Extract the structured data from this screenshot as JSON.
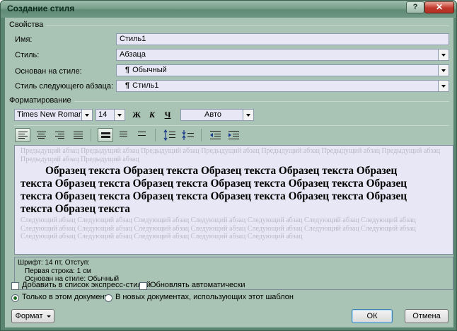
{
  "window": {
    "title": "Создание стиля",
    "help_label": "?",
    "close_label": "✕"
  },
  "properties": {
    "section_title": "Свойства",
    "name_label": "Имя:",
    "name_value": "Стиль1",
    "style_type_label": "Стиль:",
    "style_type_value": "Абзаца",
    "based_on_label": "Основан на стиле:",
    "based_on_value": "Обычный",
    "next_style_label": "Стиль следующего абзаца:",
    "next_style_value": "Стиль1",
    "pilcrow": "¶"
  },
  "formatting": {
    "section_title": "Форматирование",
    "font_name": "Times New Roman (Ос",
    "font_size": "14",
    "bold_label": "Ж",
    "italic_label": "К",
    "underline_label": "Ч",
    "color_value": "Авто"
  },
  "preview": {
    "previous_paragraph": "Предыдущий абзац Предыдущий абзац Предыдущий абзац Предыдущий абзац Предыдущий абзац Предыдущий абзац Предыдущий абзац Предыдущий абзац Предыдущий абзац",
    "sample_line1": "Образец текста Образец текста Образец текста Образец текста Образец",
    "sample_line2": "текста Образец текста Образец текста Образец текста Образец текста Образец",
    "sample_line3": "текста Образец текста Образец текста Образец текста Образец текста Образец",
    "sample_line4": "текста Образец текста",
    "next_paragraph": "Следующий абзац Следующий абзац Следующий абзац Следующий абзац Следующий абзац Следующий абзац Следующий абзац Следующий абзац Следующий абзац Следующий абзац Следующий абзац Следующий абзац Следующий абзац Следующий абзац Следующий абзац Следующий абзац Следующий абзац Следующий абзац Следующий абзац"
  },
  "description": {
    "line1": "Шрифт: 14 пт, Отступ:",
    "line2": "Первая строка:  1 см",
    "line3": "Основан на стиле: Обычный"
  },
  "options": {
    "add_to_quick_styles": "Добавить в список экспресс-стилей",
    "auto_update": "Обновлять автоматически",
    "only_this_document": "Только в этом документе",
    "new_documents": "В новых документах, использующих этот шаблон"
  },
  "buttons": {
    "format": "Формат",
    "ok": "ОК",
    "cancel": "Отмена"
  }
}
